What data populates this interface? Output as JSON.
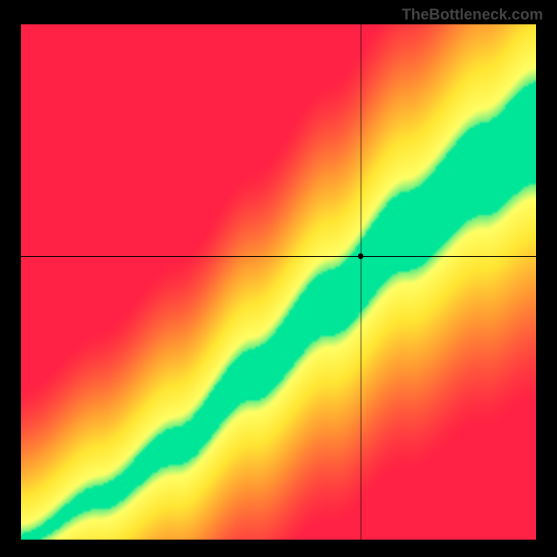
{
  "watermark": "TheBottleneck.com",
  "chart_data": {
    "type": "heatmap",
    "title": "",
    "xlabel": "",
    "ylabel": "",
    "xlim": [
      0,
      100
    ],
    "ylim": [
      0,
      100
    ],
    "marker": {
      "x": 66,
      "y": 55
    },
    "crosshair": {
      "x": 66,
      "y": 55
    },
    "colorscale": [
      {
        "value": 0.0,
        "color": "#ff2244"
      },
      {
        "value": 0.35,
        "color": "#ff9933"
      },
      {
        "value": 0.6,
        "color": "#ffe633"
      },
      {
        "value": 0.82,
        "color": "#ffff66"
      },
      {
        "value": 0.95,
        "color": "#00e699"
      },
      {
        "value": 1.0,
        "color": "#00e699"
      }
    ],
    "ridge": {
      "description": "Optimal GPU-to-CPU balance curve; closeness to ridge = green (low bottleneck), far = red (high bottleneck).",
      "control_points": [
        {
          "x": 0,
          "y": 0
        },
        {
          "x": 15,
          "y": 8
        },
        {
          "x": 30,
          "y": 18
        },
        {
          "x": 45,
          "y": 32
        },
        {
          "x": 60,
          "y": 46
        },
        {
          "x": 75,
          "y": 60
        },
        {
          "x": 90,
          "y": 72
        },
        {
          "x": 100,
          "y": 79
        }
      ],
      "band_halfwidth_at_0": 1.0,
      "band_halfwidth_at_100": 10.0
    }
  }
}
